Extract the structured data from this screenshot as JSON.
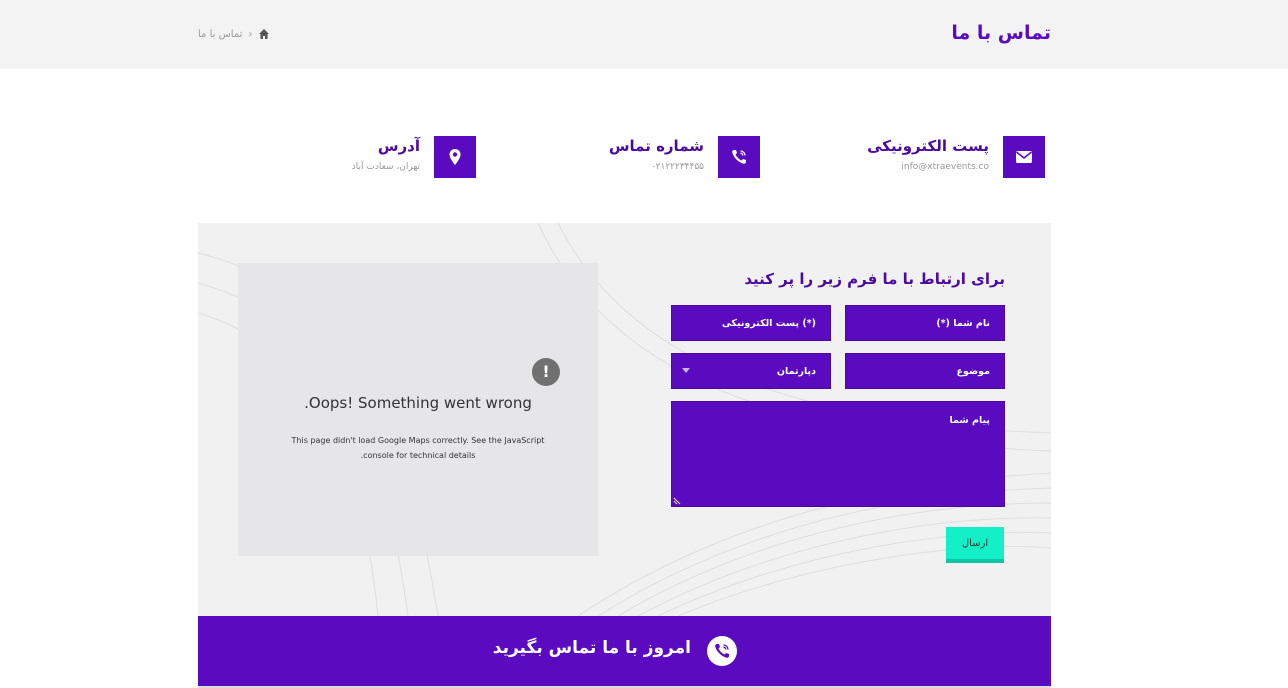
{
  "header": {
    "title": "تماس با ما",
    "breadcrumb": {
      "current": "تماس با ما",
      "home_icon": "home-icon",
      "separator": "›"
    }
  },
  "info": {
    "email": {
      "title": "پست الکترونیکی",
      "value": "info@xtraevents.co",
      "icon": "envelope-icon"
    },
    "phone": {
      "title": "شماره تماس",
      "value": "۰۲۱۲۲۲۳۴۴۵۵",
      "icon": "phone-icon"
    },
    "address": {
      "title": "آدرس",
      "value": "تهران، سعادت آباد",
      "icon": "location-pin-icon"
    }
  },
  "map": {
    "error_title": "Oops! Something went wrong.",
    "error_desc": "This page didn't load Google Maps correctly. See the JavaScript console for technical details.",
    "icon": "warning-icon"
  },
  "form": {
    "heading": "برای ارتباط با ما فرم زیر را پر کنید",
    "name_placeholder": "نام شما (*)",
    "email_placeholder": "(*) پست الکترونیکی",
    "subject_placeholder": "موضوع",
    "department_selected": "دپارتمان",
    "message_placeholder": "پیام شما",
    "send_label": "ارسال"
  },
  "cta": {
    "text": "امروز با ما تماس بگیرید",
    "icon": "phone-call-icon"
  },
  "colors": {
    "brand": "#5a0bc0",
    "accent": "#13f0c8",
    "topbar": "#f3f3f3",
    "panel": "#f1f1f1"
  }
}
